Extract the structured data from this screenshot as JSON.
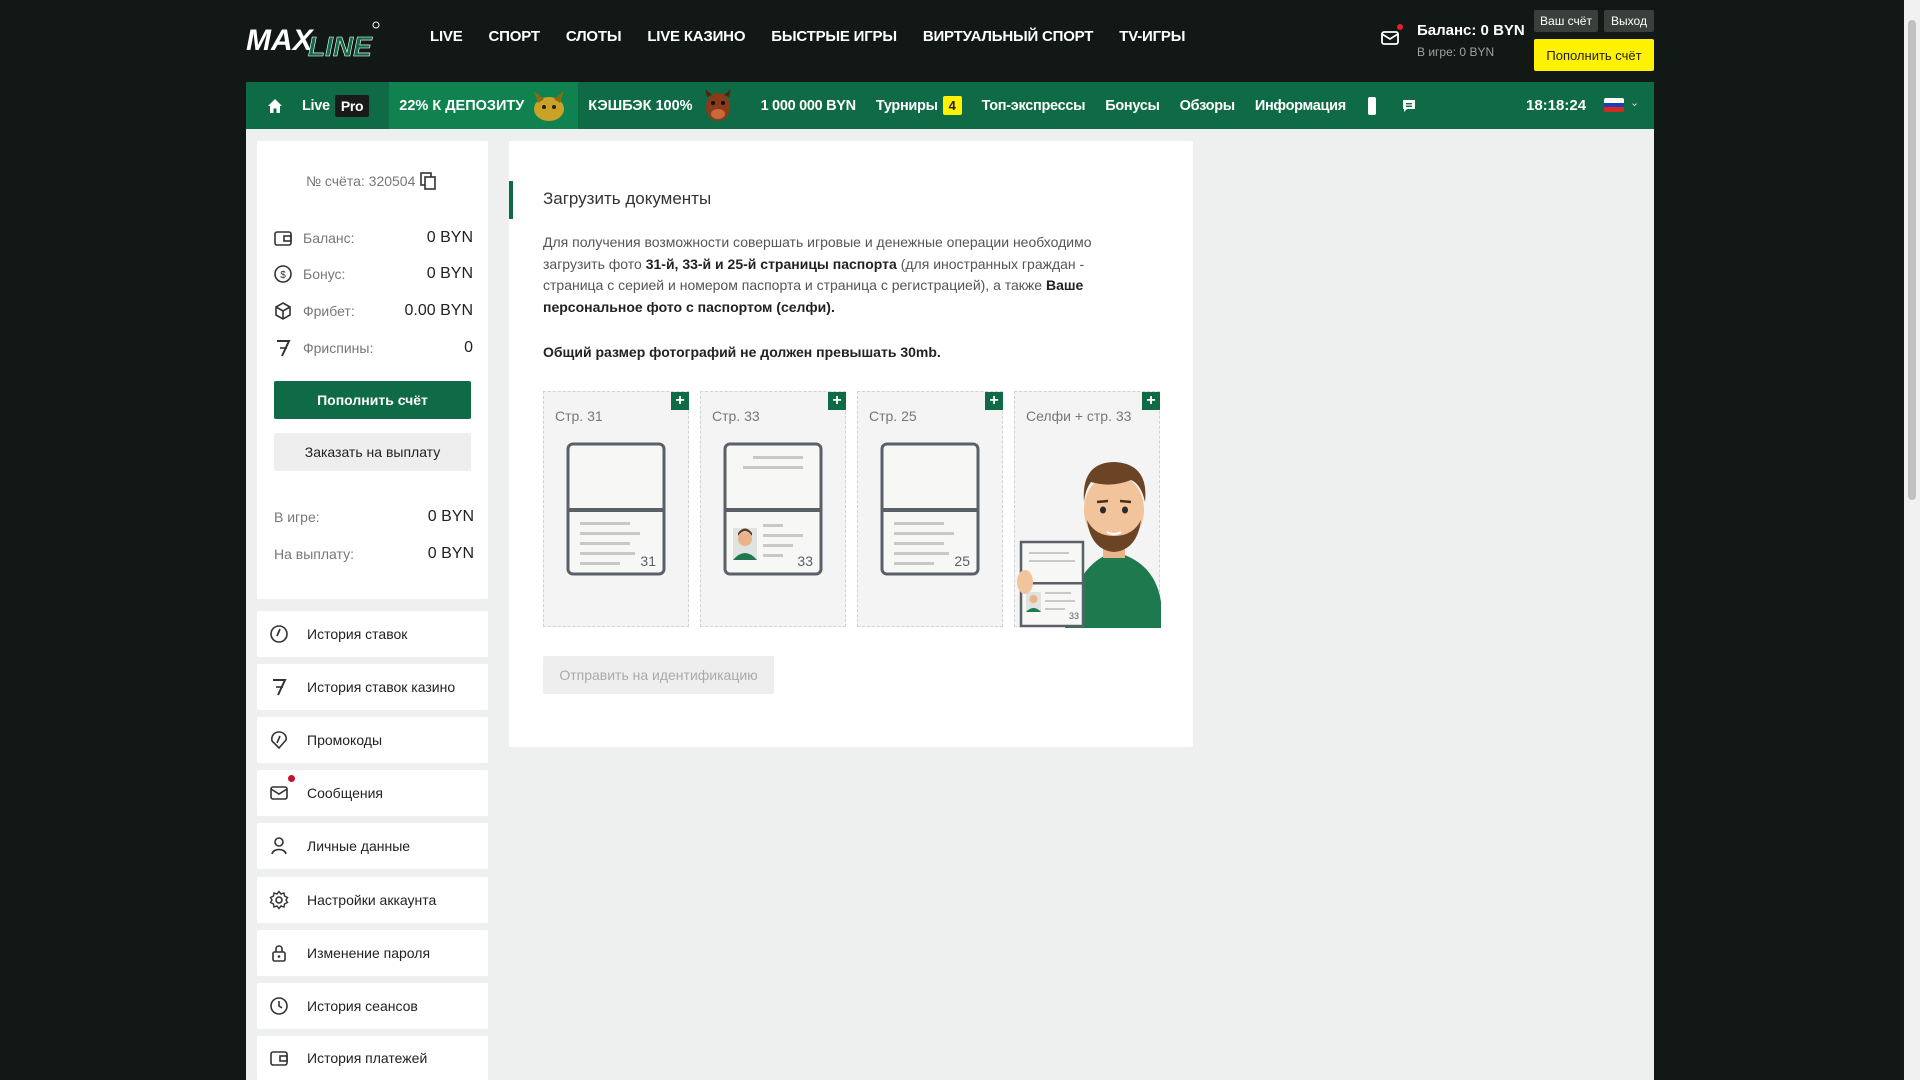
{
  "brand": {
    "logo_text": "MAXLINE"
  },
  "top_nav": [
    "LIVE",
    "СПОРТ",
    "СЛОТЫ",
    "LIVE КАЗИНО",
    "БЫСТРЫЕ ИГРЫ",
    "ВИРТУАЛЬНЫЙ СПОРТ",
    "TV-ИГРЫ"
  ],
  "header": {
    "balance": "Баланс: 0 BYN",
    "in_game": "В игре: 0 BYN",
    "account_button": "Ваш счёт",
    "logout_button": "Выход",
    "deposit_button": "Пополнить счёт"
  },
  "sub_nav": {
    "live": "Live",
    "pro": "Pro",
    "promo_deposit": "22% К ДЕПОЗИТУ",
    "promo_cashback": "КЭШБЭК 100%",
    "jackpot": "1 000 000 BYN",
    "tournaments": "Турниры",
    "tournaments_badge": "4",
    "top_express": "Топ-экспрессы",
    "bonuses": "Бонусы",
    "reviews": "Обзоры",
    "info": "Информация",
    "time": "18:18:24"
  },
  "account": {
    "number": "№ счёта: 320504",
    "rows": [
      {
        "label": "Баланс:",
        "value": "0 BYN"
      },
      {
        "label": "Бонус:",
        "value": "0 BYN"
      },
      {
        "label": "Фрибет:",
        "value": "0.00 BYN"
      },
      {
        "label": "Фриспины:",
        "value": "0"
      }
    ],
    "deposit_button": "Пополнить счёт",
    "withdraw_button": "Заказать на выплату",
    "in_game_label": "В игре:",
    "in_game_value": "0 BYN",
    "payout_label": "На выплату:",
    "payout_value": "0 BYN"
  },
  "menu": [
    {
      "label": "История ставок",
      "icon": "bet-history-icon"
    },
    {
      "label": "История ставок казино",
      "icon": "casino-seven-icon"
    },
    {
      "label": "Промокоды",
      "icon": "promo-tag-icon"
    },
    {
      "label": "Сообщения",
      "icon": "mail-icon"
    },
    {
      "label": "Личные данные",
      "icon": "user-icon"
    },
    {
      "label": "Настройки аккаунта",
      "icon": "gear-icon"
    },
    {
      "label": "Изменение пароля",
      "icon": "lock-icon"
    },
    {
      "label": "История сеансов",
      "icon": "clock-icon"
    },
    {
      "label": "История платежей",
      "icon": "wallet-icon"
    }
  ],
  "documents": {
    "title": "Загрузить документы",
    "desc_1": "Для получения возможности совершать игровые и денежные операции необходимо загрузить фото ",
    "desc_bold_1": "31-й, 33-й и 25-й страницы паспорта",
    "desc_2": " (для иностранных граждан - страница с серией и номером паспорта и страница с регистрацией), а также ",
    "desc_bold_2": "Ваше персональное фото с паспортом (селфи).",
    "note": "Общий размер фотографий не должен превышать 30mb.",
    "tiles": [
      {
        "label": "Стр. 31",
        "page": "31"
      },
      {
        "label": "Стр. 33",
        "page": "33"
      },
      {
        "label": "Стр. 25",
        "page": "25"
      },
      {
        "label": "Селфи + стр. 33",
        "page": "33"
      }
    ],
    "send_button": "Отправить на идентификацию"
  },
  "colors": {
    "brand_green": "#0e6b45",
    "accent_yellow": "#fff200",
    "dark_bg": "#121815"
  }
}
